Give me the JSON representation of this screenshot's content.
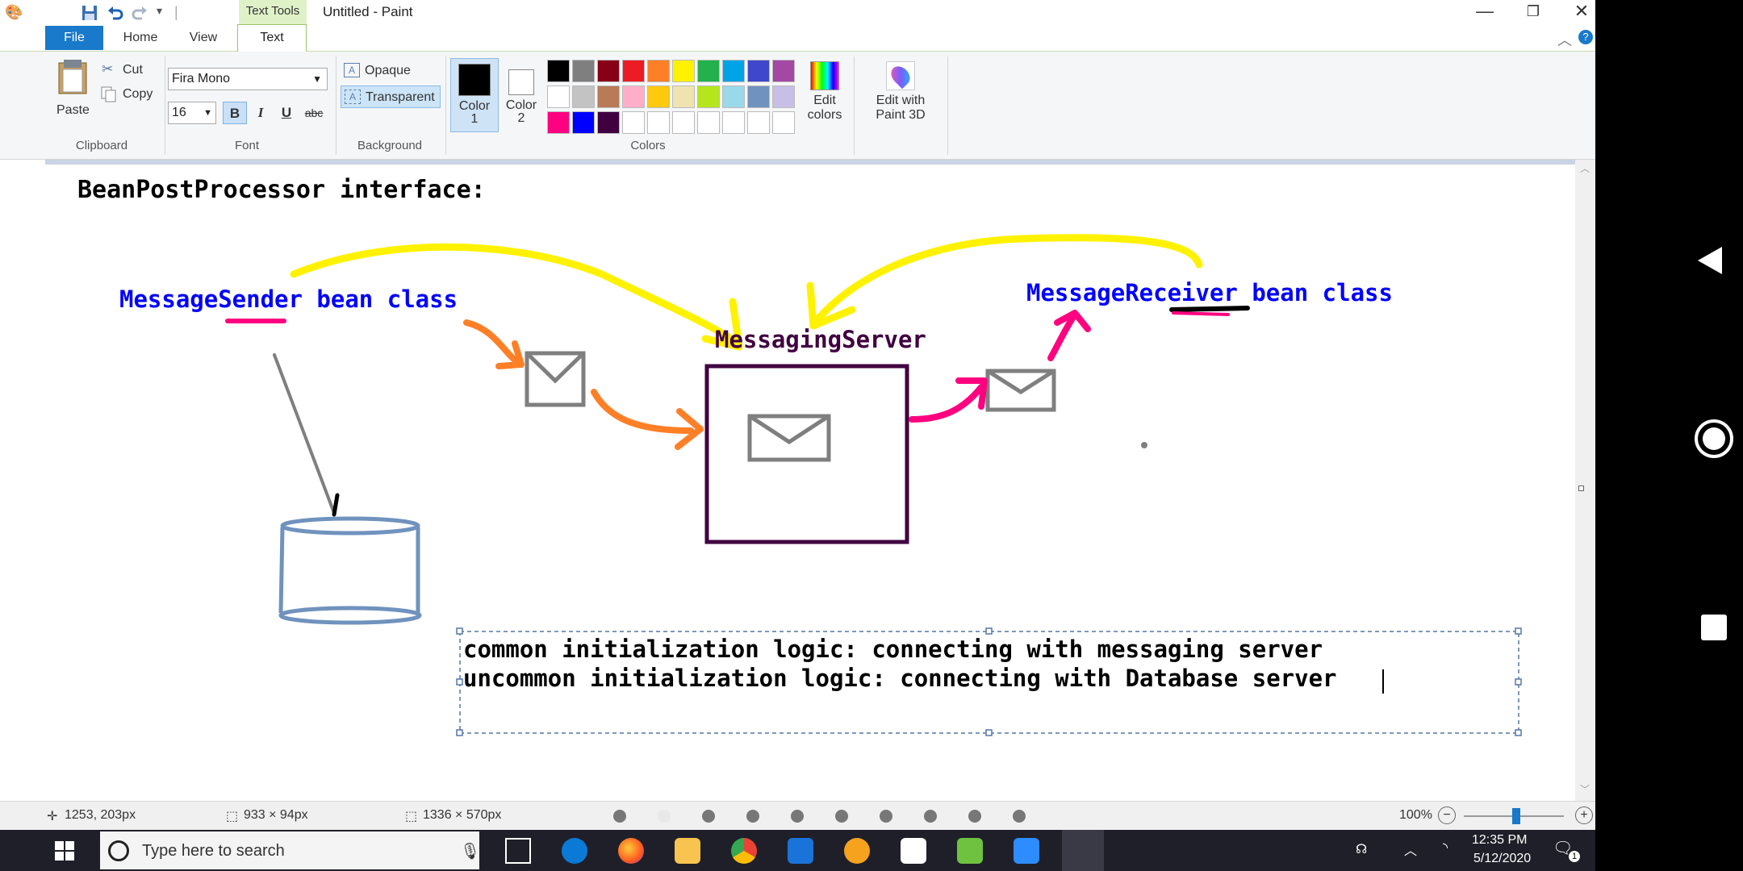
{
  "window": {
    "title": "Untitled - Paint",
    "contextual_tab": "Text Tools",
    "minimize": "—",
    "restore": "❐",
    "close": "✕"
  },
  "tabs": {
    "file": "File",
    "home": "Home",
    "view": "View",
    "text": "Text"
  },
  "ribbon": {
    "clipboard": {
      "paste": "Paste",
      "cut": "Cut",
      "copy": "Copy",
      "label": "Clipboard"
    },
    "font": {
      "family": "Fira Mono",
      "size": "16",
      "bold": "B",
      "italic": "I",
      "underline": "U",
      "strike": "abc",
      "label": "Font"
    },
    "background": {
      "opaque": "Opaque",
      "transparent": "Transparent",
      "label": "Background"
    },
    "colors": {
      "color1": "Color",
      "color1_num": "1",
      "color2": "Color",
      "color2_num": "2",
      "edit_colors_1": "Edit",
      "edit_colors_2": "colors",
      "label": "Colors",
      "palette_row1": [
        "#000000",
        "#7f7f7f",
        "#880015",
        "#ed1c24",
        "#ff7f27",
        "#fff200",
        "#22b14c",
        "#00a2e8",
        "#3f48cc",
        "#a349a4"
      ],
      "palette_row2": [
        "#ffffff",
        "#c3c3c3",
        "#b97a57",
        "#ffaec9",
        "#ffc90e",
        "#efe4b0",
        "#b5e61d",
        "#99d9ea",
        "#7092be",
        "#c8bfe7"
      ],
      "palette_row3": [
        "#ff0080",
        "#0000ff",
        "#400040",
        "#ffffff",
        "#ffffff",
        "#ffffff",
        "#ffffff",
        "#ffffff",
        "#ffffff",
        "#ffffff"
      ]
    },
    "paint3d": {
      "line1": "Edit with",
      "line2": "Paint 3D"
    }
  },
  "canvas": {
    "heading": "BeanPostProcessor interface:",
    "sender_label": "MessageSender bean class",
    "receiver_label": "MessageReceiver bean class",
    "server_label": "MessagingServer",
    "textbox_line1": "common initialization logic: connecting with messaging server",
    "textbox_line2": "uncommon initialization logic: connecting with Database server"
  },
  "status": {
    "cursor": "1253, 203px",
    "selection": "933 × 94px",
    "canvas_size": "1336 × 570px",
    "zoom": "100%"
  },
  "taskbar": {
    "search_placeholder": "Type here to search",
    "time": "12:35 PM",
    "date": "5/12/2020",
    "notifications": "1"
  }
}
